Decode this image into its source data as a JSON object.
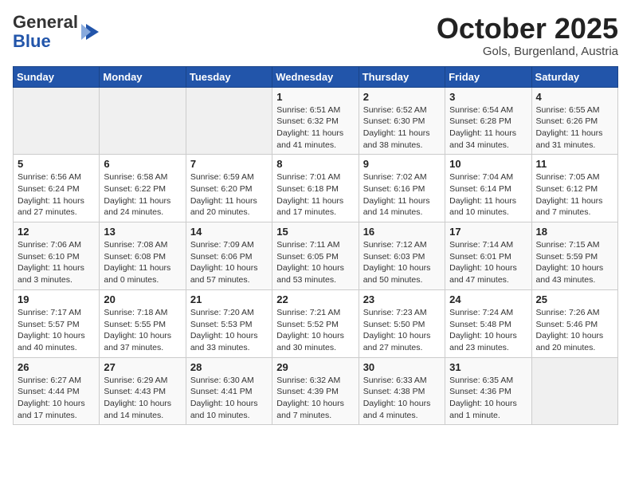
{
  "header": {
    "logo_general": "General",
    "logo_blue": "Blue",
    "month_title": "October 2025",
    "location": "Gols, Burgenland, Austria"
  },
  "days_of_week": [
    "Sunday",
    "Monday",
    "Tuesday",
    "Wednesday",
    "Thursday",
    "Friday",
    "Saturday"
  ],
  "weeks": [
    [
      {
        "day": "",
        "info": ""
      },
      {
        "day": "",
        "info": ""
      },
      {
        "day": "",
        "info": ""
      },
      {
        "day": "1",
        "info": "Sunrise: 6:51 AM\nSunset: 6:32 PM\nDaylight: 11 hours\nand 41 minutes."
      },
      {
        "day": "2",
        "info": "Sunrise: 6:52 AM\nSunset: 6:30 PM\nDaylight: 11 hours\nand 38 minutes."
      },
      {
        "day": "3",
        "info": "Sunrise: 6:54 AM\nSunset: 6:28 PM\nDaylight: 11 hours\nand 34 minutes."
      },
      {
        "day": "4",
        "info": "Sunrise: 6:55 AM\nSunset: 6:26 PM\nDaylight: 11 hours\nand 31 minutes."
      }
    ],
    [
      {
        "day": "5",
        "info": "Sunrise: 6:56 AM\nSunset: 6:24 PM\nDaylight: 11 hours\nand 27 minutes."
      },
      {
        "day": "6",
        "info": "Sunrise: 6:58 AM\nSunset: 6:22 PM\nDaylight: 11 hours\nand 24 minutes."
      },
      {
        "day": "7",
        "info": "Sunrise: 6:59 AM\nSunset: 6:20 PM\nDaylight: 11 hours\nand 20 minutes."
      },
      {
        "day": "8",
        "info": "Sunrise: 7:01 AM\nSunset: 6:18 PM\nDaylight: 11 hours\nand 17 minutes."
      },
      {
        "day": "9",
        "info": "Sunrise: 7:02 AM\nSunset: 6:16 PM\nDaylight: 11 hours\nand 14 minutes."
      },
      {
        "day": "10",
        "info": "Sunrise: 7:04 AM\nSunset: 6:14 PM\nDaylight: 11 hours\nand 10 minutes."
      },
      {
        "day": "11",
        "info": "Sunrise: 7:05 AM\nSunset: 6:12 PM\nDaylight: 11 hours\nand 7 minutes."
      }
    ],
    [
      {
        "day": "12",
        "info": "Sunrise: 7:06 AM\nSunset: 6:10 PM\nDaylight: 11 hours\nand 3 minutes."
      },
      {
        "day": "13",
        "info": "Sunrise: 7:08 AM\nSunset: 6:08 PM\nDaylight: 11 hours\nand 0 minutes."
      },
      {
        "day": "14",
        "info": "Sunrise: 7:09 AM\nSunset: 6:06 PM\nDaylight: 10 hours\nand 57 minutes."
      },
      {
        "day": "15",
        "info": "Sunrise: 7:11 AM\nSunset: 6:05 PM\nDaylight: 10 hours\nand 53 minutes."
      },
      {
        "day": "16",
        "info": "Sunrise: 7:12 AM\nSunset: 6:03 PM\nDaylight: 10 hours\nand 50 minutes."
      },
      {
        "day": "17",
        "info": "Sunrise: 7:14 AM\nSunset: 6:01 PM\nDaylight: 10 hours\nand 47 minutes."
      },
      {
        "day": "18",
        "info": "Sunrise: 7:15 AM\nSunset: 5:59 PM\nDaylight: 10 hours\nand 43 minutes."
      }
    ],
    [
      {
        "day": "19",
        "info": "Sunrise: 7:17 AM\nSunset: 5:57 PM\nDaylight: 10 hours\nand 40 minutes."
      },
      {
        "day": "20",
        "info": "Sunrise: 7:18 AM\nSunset: 5:55 PM\nDaylight: 10 hours\nand 37 minutes."
      },
      {
        "day": "21",
        "info": "Sunrise: 7:20 AM\nSunset: 5:53 PM\nDaylight: 10 hours\nand 33 minutes."
      },
      {
        "day": "22",
        "info": "Sunrise: 7:21 AM\nSunset: 5:52 PM\nDaylight: 10 hours\nand 30 minutes."
      },
      {
        "day": "23",
        "info": "Sunrise: 7:23 AM\nSunset: 5:50 PM\nDaylight: 10 hours\nand 27 minutes."
      },
      {
        "day": "24",
        "info": "Sunrise: 7:24 AM\nSunset: 5:48 PM\nDaylight: 10 hours\nand 23 minutes."
      },
      {
        "day": "25",
        "info": "Sunrise: 7:26 AM\nSunset: 5:46 PM\nDaylight: 10 hours\nand 20 minutes."
      }
    ],
    [
      {
        "day": "26",
        "info": "Sunrise: 6:27 AM\nSunset: 4:44 PM\nDaylight: 10 hours\nand 17 minutes."
      },
      {
        "day": "27",
        "info": "Sunrise: 6:29 AM\nSunset: 4:43 PM\nDaylight: 10 hours\nand 14 minutes."
      },
      {
        "day": "28",
        "info": "Sunrise: 6:30 AM\nSunset: 4:41 PM\nDaylight: 10 hours\nand 10 minutes."
      },
      {
        "day": "29",
        "info": "Sunrise: 6:32 AM\nSunset: 4:39 PM\nDaylight: 10 hours\nand 7 minutes."
      },
      {
        "day": "30",
        "info": "Sunrise: 6:33 AM\nSunset: 4:38 PM\nDaylight: 10 hours\nand 4 minutes."
      },
      {
        "day": "31",
        "info": "Sunrise: 6:35 AM\nSunset: 4:36 PM\nDaylight: 10 hours\nand 1 minute."
      },
      {
        "day": "",
        "info": ""
      }
    ]
  ]
}
